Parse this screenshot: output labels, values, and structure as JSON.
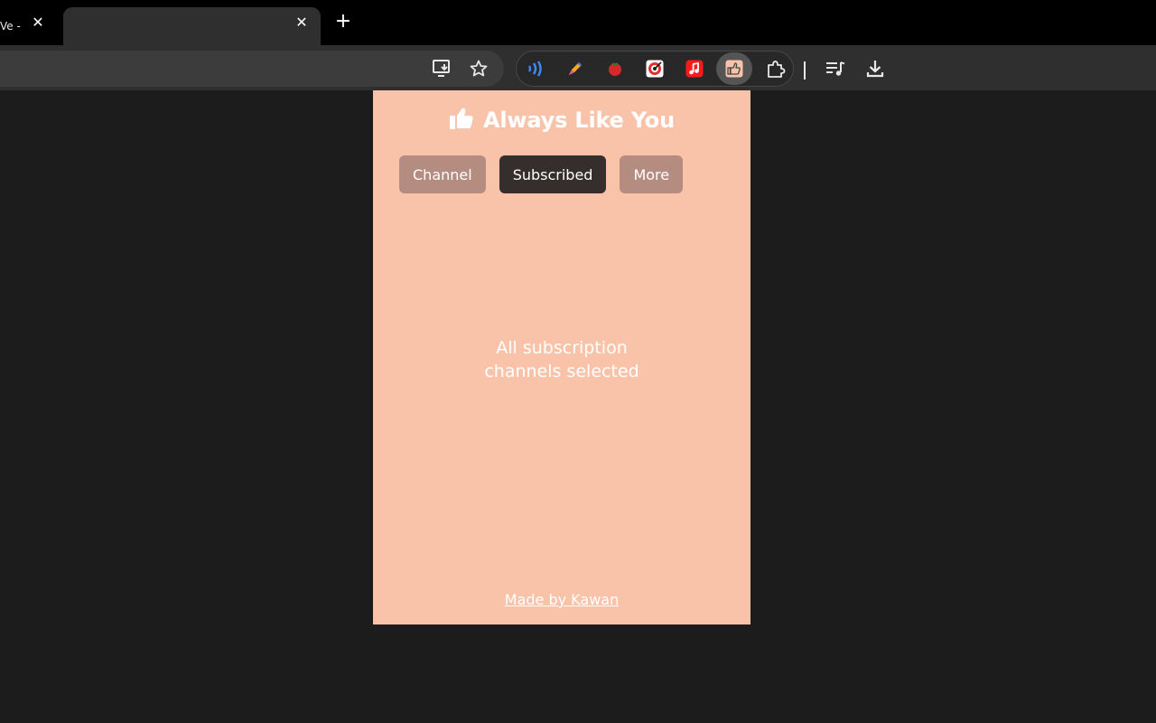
{
  "browser": {
    "tabs": [
      {
        "title": "Ve -",
        "close": "✕"
      },
      {
        "title": "",
        "close": "✕"
      }
    ],
    "new_tab": "+",
    "toolbar_icons": [
      "install-app-icon",
      "bookmark-star-icon",
      "media-controls-icon",
      "download-icon"
    ],
    "extensions": [
      "wave-extension-icon",
      "pen-extension-icon",
      "tomato-extension-icon",
      "target-extension-icon",
      "music-extension-icon",
      "always-like-you-extension-icon",
      "extensions-puzzle-icon"
    ]
  },
  "popup": {
    "title": "Always Like You",
    "title_icon": "thumbs-up-icon",
    "tabs": [
      {
        "label": "Channel",
        "active": false
      },
      {
        "label": "Subscribed",
        "active": true
      },
      {
        "label": "More",
        "active": false
      }
    ],
    "status_line1": "All subscription",
    "status_line2": "channels selected",
    "footer": "Made by Kawan"
  },
  "colors": {
    "popup_bg": "#f9c3aa",
    "pill_inactive": "#b48d80",
    "pill_active": "#362e2c",
    "page_bg": "#1c1c1c"
  }
}
